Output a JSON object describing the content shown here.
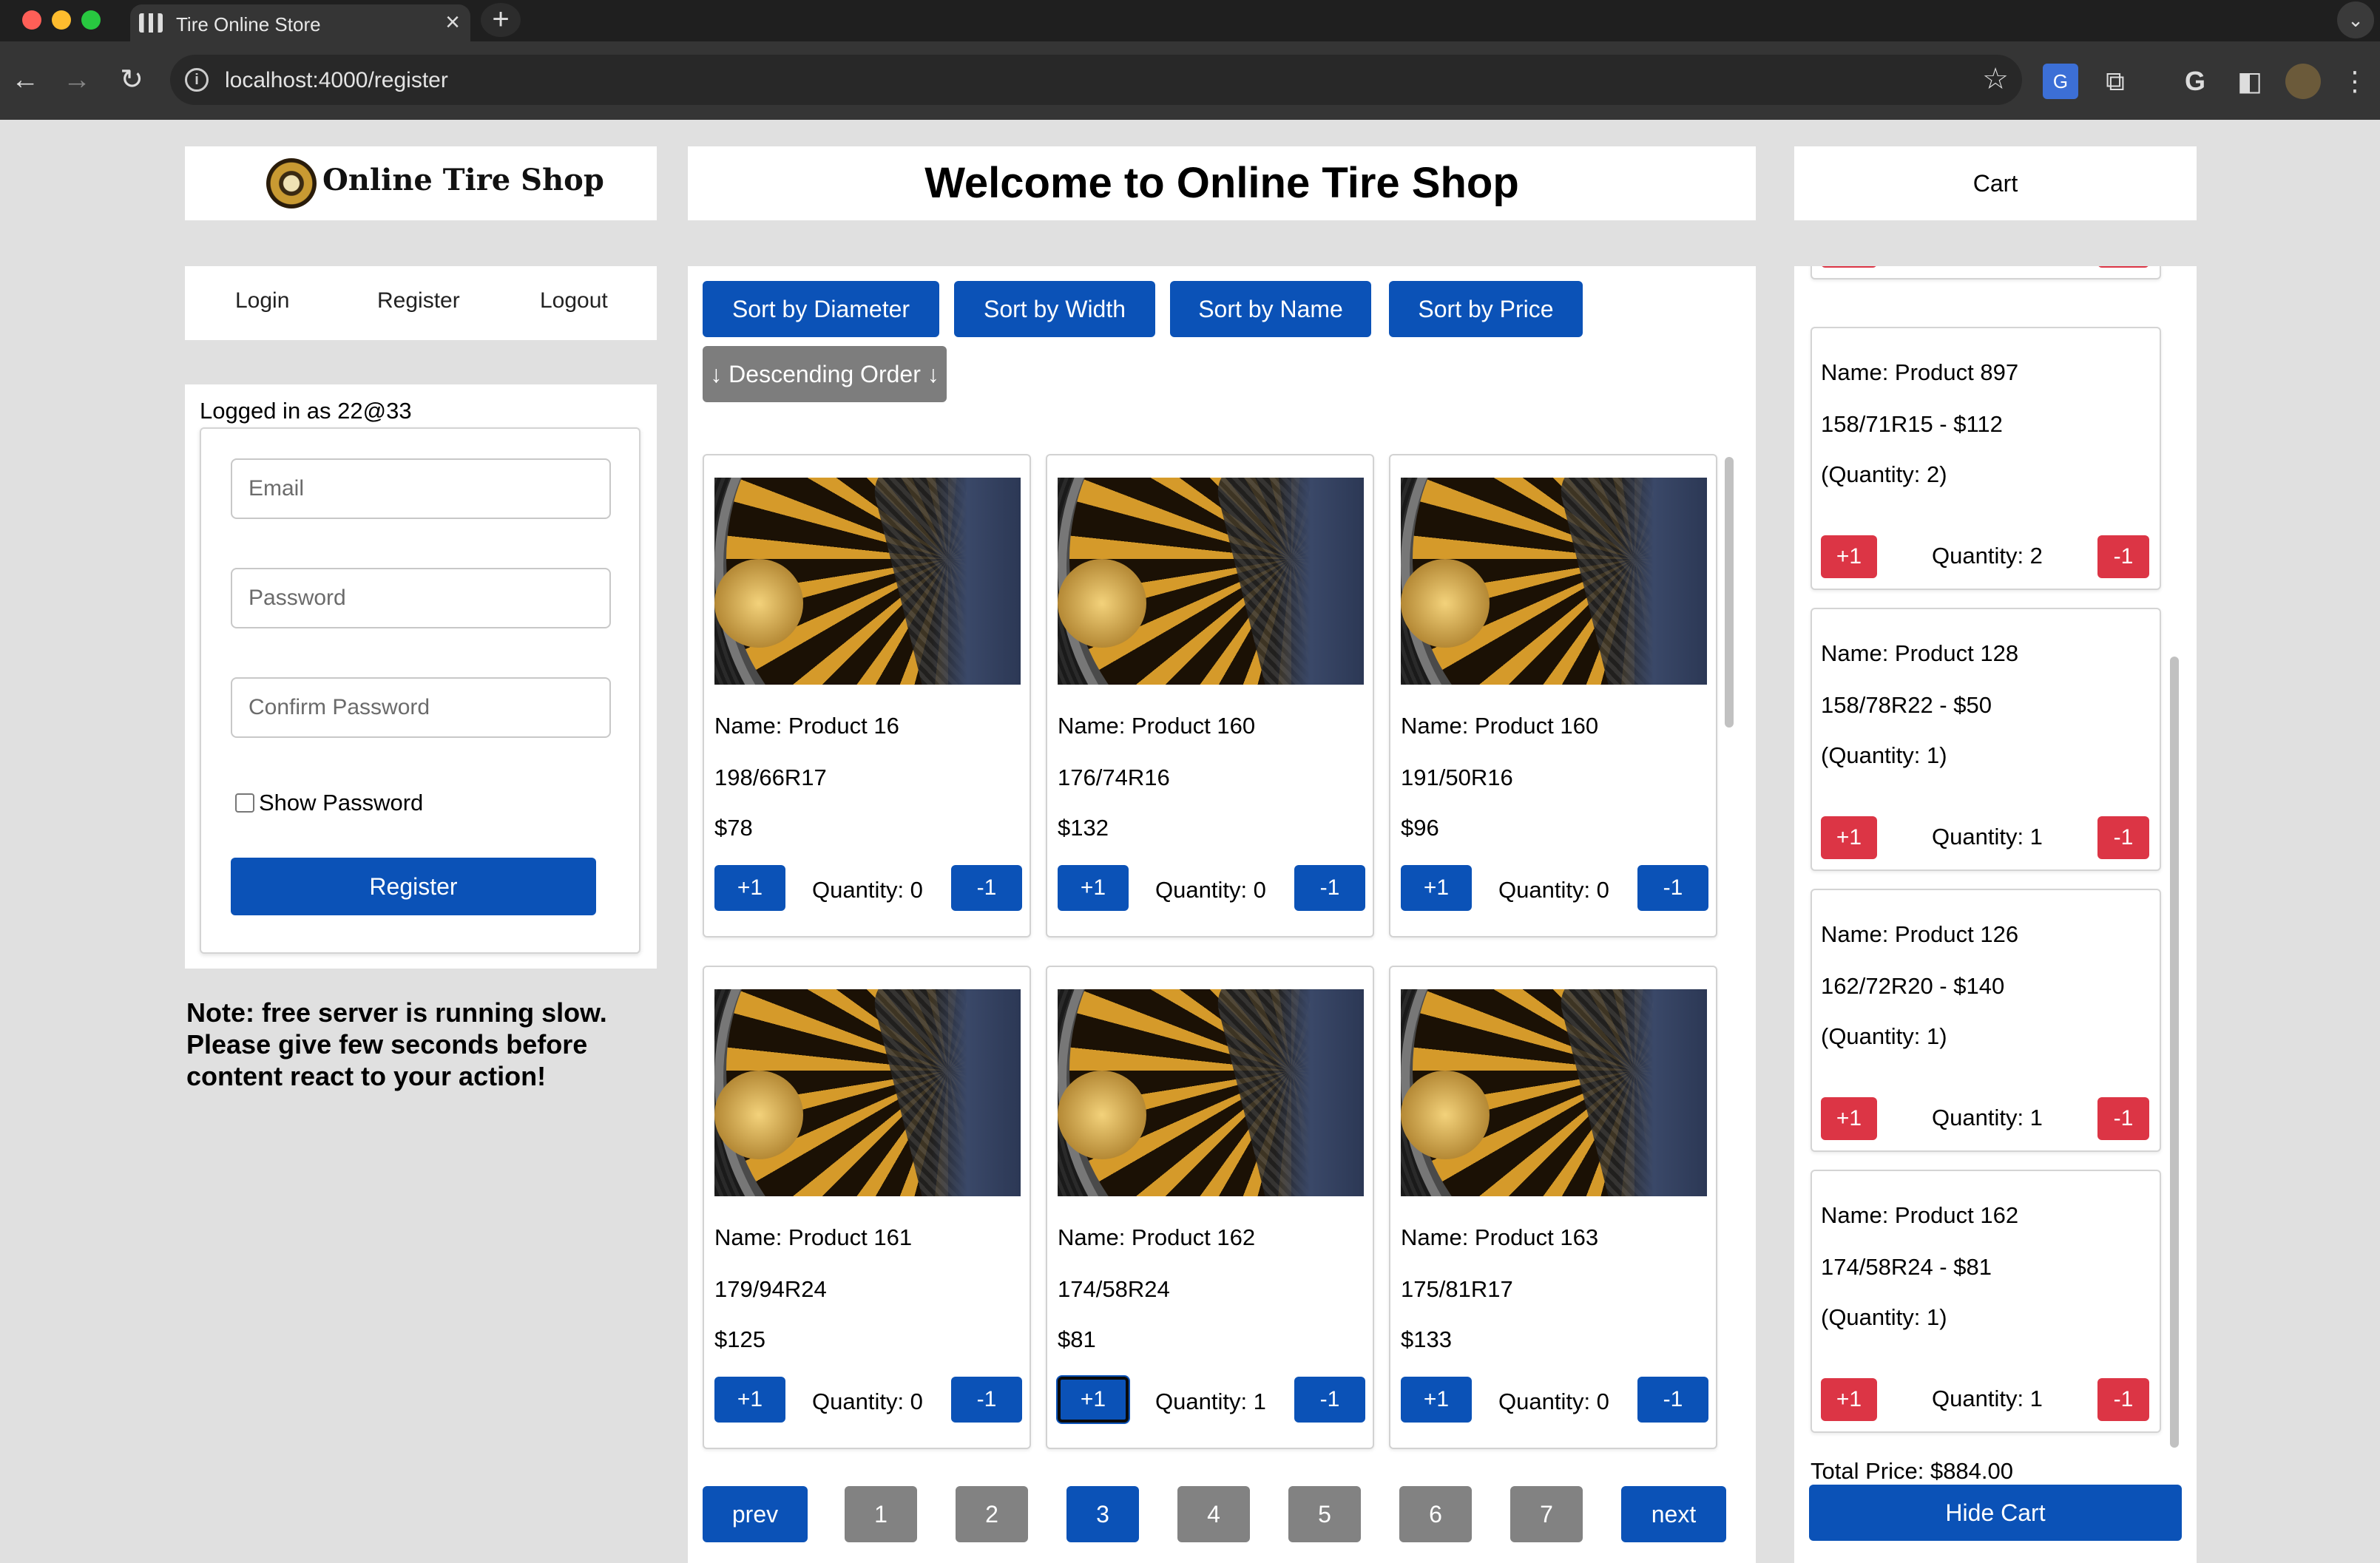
{
  "browser": {
    "tab_title": "Tire Online Store",
    "tab_close": "×",
    "new_tab": "+",
    "url": "localhost:4000/register"
  },
  "header": {
    "logo_text": "Online Tire Shop",
    "welcome": "Welcome to Online Tire Shop",
    "cart_title": "Cart"
  },
  "auth_nav": {
    "login": "Login",
    "register": "Register",
    "logout": "Logout"
  },
  "auth": {
    "logged_in_as": "Logged in as 22@33",
    "email_placeholder": "Email",
    "password_placeholder": "Password",
    "confirm_placeholder": "Confirm Password",
    "show_password": "Show Password",
    "register_button": "Register"
  },
  "note": "Note: free server is running slow. Please give few seconds before content react to your action!",
  "sort": {
    "diameter": "Sort by Diameter",
    "width": "Sort by Width",
    "name": "Sort by Name",
    "price": "Sort by Price",
    "order": "↓ Descending Order ↓"
  },
  "products": [
    {
      "name": "Name: Product 16",
      "size": "198/66R17",
      "price": "$78",
      "quantity": "Quantity: 0",
      "plus": "+1",
      "minus": "-1"
    },
    {
      "name": "Name: Product 160",
      "size": "176/74R16",
      "price": "$132",
      "quantity": "Quantity: 0",
      "plus": "+1",
      "minus": "-1"
    },
    {
      "name": "Name: Product 160",
      "size": "191/50R16",
      "price": "$96",
      "quantity": "Quantity: 0",
      "plus": "+1",
      "minus": "-1"
    },
    {
      "name": "Name: Product 161",
      "size": "179/94R24",
      "price": "$125",
      "quantity": "Quantity: 0",
      "plus": "+1",
      "minus": "-1"
    },
    {
      "name": "Name: Product 162",
      "size": "174/58R24",
      "price": "$81",
      "quantity": "Quantity: 1",
      "plus": "+1",
      "minus": "-1"
    },
    {
      "name": "Name: Product 163",
      "size": "175/81R17",
      "price": "$133",
      "quantity": "Quantity: 0",
      "plus": "+1",
      "minus": "-1"
    }
  ],
  "pagination": {
    "prev": "prev",
    "pages": [
      "1",
      "2",
      "3",
      "4",
      "5",
      "6",
      "7"
    ],
    "current": "3",
    "next": "next"
  },
  "cart": {
    "items": [
      {
        "name": "Name: Product 897",
        "detail": "158/71R15 - $112",
        "qty_paren": "(Quantity: 2)",
        "quantity": "Quantity: 2",
        "plus": "+1",
        "minus": "-1"
      },
      {
        "name": "Name: Product 128",
        "detail": "158/78R22 - $50",
        "qty_paren": "(Quantity: 1)",
        "quantity": "Quantity: 1",
        "plus": "+1",
        "minus": "-1"
      },
      {
        "name": "Name: Product 126",
        "detail": "162/72R20 - $140",
        "qty_paren": "(Quantity: 1)",
        "quantity": "Quantity: 1",
        "plus": "+1",
        "minus": "-1"
      },
      {
        "name": "Name: Product 162",
        "detail": "174/58R24 - $81",
        "qty_paren": "(Quantity: 1)",
        "quantity": "Quantity: 1",
        "plus": "+1",
        "minus": "-1"
      }
    ],
    "total": "Total Price: $884.00",
    "hide_button": "Hide Cart"
  },
  "colors": {
    "primary_blue": "#0b52b7",
    "danger_red": "#dc3545",
    "gray_button": "#828282",
    "page_bg": "#e0e0e0"
  }
}
